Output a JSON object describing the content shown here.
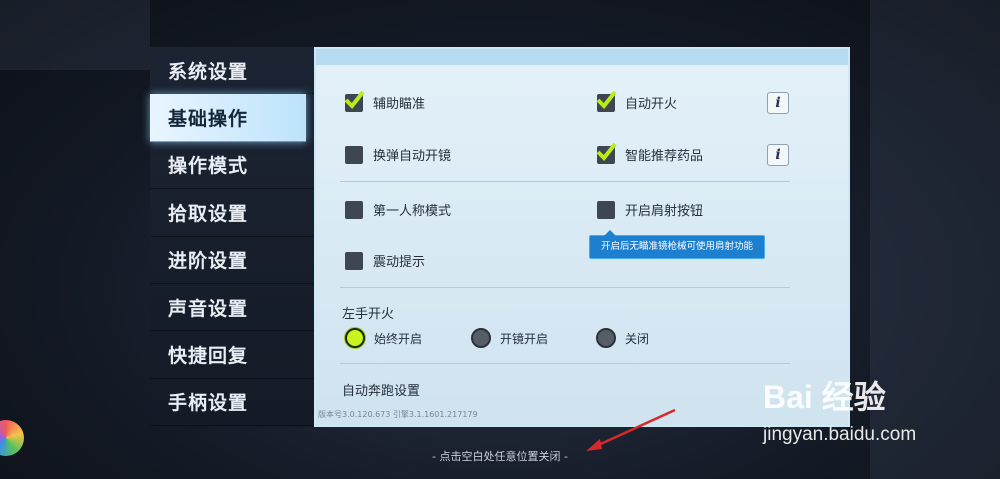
{
  "sidebar": {
    "items": [
      {
        "label": "系统设置",
        "active": false
      },
      {
        "label": "基础操作",
        "active": true
      },
      {
        "label": "操作模式",
        "active": false
      },
      {
        "label": "拾取设置",
        "active": false
      },
      {
        "label": "进阶设置",
        "active": false
      },
      {
        "label": "声音设置",
        "active": false
      },
      {
        "label": "快捷回复",
        "active": false
      },
      {
        "label": "手柄设置",
        "active": false
      }
    ]
  },
  "options": {
    "aim_assist": {
      "label": "辅助瞄准",
      "checked": true
    },
    "auto_fire": {
      "label": "自动开火",
      "checked": true
    },
    "auto_scope_reload": {
      "label": "换弹自动开镜",
      "checked": false
    },
    "smart_meds": {
      "label": "智能推荐药品",
      "checked": true
    },
    "first_person": {
      "label": "第一人称模式",
      "checked": false
    },
    "shoulder_fire": {
      "label": "开启肩射按钮",
      "checked": false
    },
    "vibration": {
      "label": "震动提示",
      "checked": false
    }
  },
  "tooltip": "开启后无瞄准镜枪械可使用肩射功能",
  "info_icon_glyph": "i",
  "left_fire": {
    "title": "左手开火",
    "choices": [
      {
        "label": "始终开启",
        "selected": true
      },
      {
        "label": "开镜开启",
        "selected": false
      },
      {
        "label": "关闭",
        "selected": false
      }
    ]
  },
  "auto_run_title": "自动奔跑设置",
  "version_text": "版本号3.0.120.673   引擎3.1.1601.217179",
  "close_hint": "- 点击空白处任意位置关闭 -",
  "watermark": {
    "logo": "Bai 经验",
    "url": "jingyan.baidu.com"
  },
  "colors": {
    "accent_check": "#c9f51f",
    "tooltip_bg": "#1d7fd0",
    "arrow": "#d62a2a"
  }
}
